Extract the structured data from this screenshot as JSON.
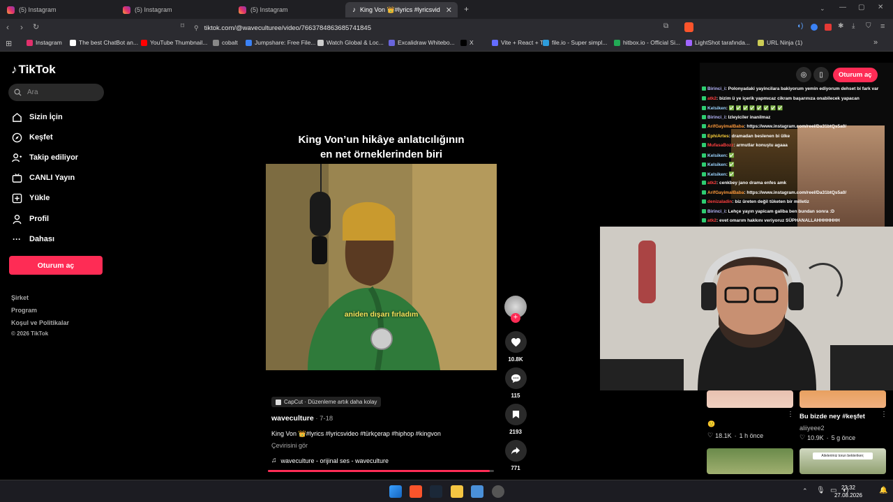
{
  "browser": {
    "tabs": [
      {
        "title": "(5) Instagram"
      },
      {
        "title": "(5) Instagram"
      },
      {
        "title": "(5) Instagram"
      },
      {
        "title": "King Von 👑#lyrics #lyricsvideo"
      }
    ],
    "url": "tiktok.com/@waveculturee/video/7663784863685741845",
    "bookmarks": [
      {
        "label": "Instagram",
        "color": "#e1306c"
      },
      {
        "label": "The best ChatBot an...",
        "color": "#ffffff"
      },
      {
        "label": "YouTube Thumbnail...",
        "color": "#ff0000"
      },
      {
        "label": "cobalt",
        "color": "#888888"
      },
      {
        "label": "Jumpshare: Free File...",
        "color": "#3b82f6"
      },
      {
        "label": "Watch Global & Loc...",
        "color": "#cccccc"
      },
      {
        "label": "Excalidraw Whitebo...",
        "color": "#6965db"
      },
      {
        "label": "X",
        "color": "#000000"
      },
      {
        "label": "Vite + React + TS",
        "color": "#646cff"
      },
      {
        "label": "file.io - Super simpl...",
        "color": "#2d9cdb"
      },
      {
        "label": "hitbox.io - Official Si...",
        "color": "#22aa55"
      },
      {
        "label": "LightShot tarafında...",
        "color": "#a065ff"
      },
      {
        "label": "URL Ninja (1)",
        "color": "#cccc55"
      }
    ]
  },
  "tiktok": {
    "logo": "TikTok",
    "search_placeholder": "Ara",
    "nav": [
      {
        "label": "Sizin İçin",
        "icon": "home-icon"
      },
      {
        "label": "Keşfet",
        "icon": "compass-icon"
      },
      {
        "label": "Takip ediliyor",
        "icon": "following-icon"
      },
      {
        "label": "CANLI Yayın",
        "icon": "live-icon"
      },
      {
        "label": "Yükle",
        "icon": "upload-icon"
      },
      {
        "label": "Profil",
        "icon": "profile-icon"
      },
      {
        "label": "Dahası",
        "icon": "more-icon"
      }
    ],
    "login_button": "Oturum aç",
    "footer": [
      "Şirket",
      "Program",
      "Koşul ve Politikalar",
      "© 2026 TikTok"
    ],
    "accent": "#fe2c55"
  },
  "video": {
    "title_line1": "King Von’un hikâye anlatıcılığının",
    "title_line2": "en net örneklerinden biri",
    "caption": "aniden dışarı fırladım",
    "capcut": "CapCut · Düzenleme artık daha kolay",
    "author": "waveculture",
    "date": " · 7-18",
    "description": "King Von 👑#lyrics #lyricsvideo #türkçerap #hiphop #kingvon",
    "translate": "Çevirisini gör",
    "music": "waveculture - orijinal ses - waveculture",
    "progress": 0.98,
    "likes": "10.8K",
    "comments": "115",
    "saves": "2193",
    "shares": "771"
  },
  "panel": {
    "login_button": "Oturum aç",
    "chat": [
      {
        "user": "Birinci_i",
        "msg": ": Polonyadaki yayincilara bakiyorum yemin ediyorum dehset bi fark var",
        "color": "#b9b9ff"
      },
      {
        "user": "atk2",
        "msg": ": bizim ü ye içerik yapmıcaz cikram başarınıza onabilecek yapacan",
        "color": "#ff4040"
      },
      {
        "user": "Kelsiken",
        "msg": ": ✅ ✅ ✅ ✅ ✅ ✅ ✅ ✅",
        "color": "#9bd4ff"
      },
      {
        "user": "Birinci_i",
        "msg": ": Izleyiciler inanilmaz",
        "color": "#b9b9ff"
      },
      {
        "user": "ArifGayimalBaba",
        "msg": ": https://www.instagram.com/reel/Da31btQs5a0/",
        "color": "#ff9a3c"
      },
      {
        "user": "EphiArtes",
        "msg": ": dramadan beslenen bi ülke",
        "color": "#ffd23c"
      },
      {
        "user": "MufasaBozz",
        "msg": ": armutlar konuştu agaaa",
        "color": "#ff4040"
      },
      {
        "user": "Kelsiken",
        "msg": ": ✅",
        "color": "#9bd4ff"
      },
      {
        "user": "Kelsiken",
        "msg": ": ✅",
        "color": "#9bd4ff"
      },
      {
        "user": "Kelsiken",
        "msg": ": ✅",
        "color": "#9bd4ff"
      },
      {
        "user": "atk2",
        "msg": ": cenkbey jano drama enfes amk",
        "color": "#ff4040"
      },
      {
        "user": "ArifGayimalBaba",
        "msg": ": https://www.instagram.com/reel/Da31btQs5a0/",
        "color": "#ff9a3c"
      },
      {
        "user": "denizaladin",
        "msg": ": biz üreten değil tüketen bir milletiz",
        "color": "#ff4040"
      },
      {
        "user": "Birinci_i",
        "msg": ": Lehçe yayın yapicam galiba ben bundan sonra :D",
        "color": "#b9b9ff"
      },
      {
        "user": "atk2",
        "msg": ": evet omarım hakkını veriyoruz SÜPHANALLAHHHHHHH",
        "color": "#ff4040"
      }
    ],
    "cards": [
      {
        "title": "🙂",
        "likes": "18.1K",
        "time": "1 h önce",
        "author": ""
      },
      {
        "title": "Bu bizde ney #keşfet",
        "likes": "10.9K",
        "time": "5 g önce",
        "author": "aliiyeee2"
      }
    ],
    "thumb_text": "Ailelerimiz torun bekleriken;"
  },
  "taskbar": {
    "time": "23:32",
    "date": "27.08.2026"
  }
}
